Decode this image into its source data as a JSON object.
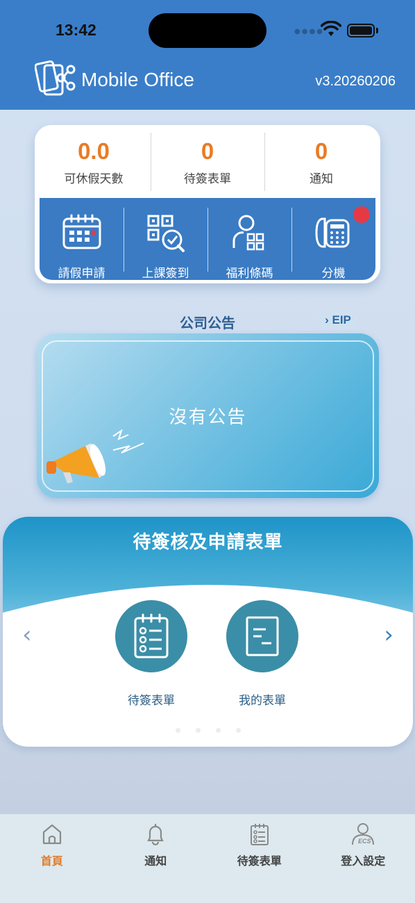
{
  "status_bar": {
    "time": "13:42"
  },
  "header": {
    "app_title": "Mobile Office",
    "version": "v3.20260206"
  },
  "stats": [
    {
      "value": "0.0",
      "label": "可休假天數"
    },
    {
      "value": "0",
      "label": "待簽表單"
    },
    {
      "value": "0",
      "label": "通知"
    }
  ],
  "quick_actions": [
    {
      "label": "請假申請",
      "icon": "calendar-icon"
    },
    {
      "label": "上課簽到",
      "icon": "qr-check-icon"
    },
    {
      "label": "福利條碼",
      "icon": "person-grid-icon"
    },
    {
      "label": "分機",
      "icon": "phone-icon"
    }
  ],
  "announcement": {
    "title": "公司公告",
    "eip_label": "EIP",
    "empty_text": "沒有公告"
  },
  "forms": {
    "title": "待簽核及申請表單",
    "items": [
      {
        "label": "待簽表單",
        "icon": "checklist-icon"
      },
      {
        "label": "我的表單",
        "icon": "document-icon"
      }
    ]
  },
  "tabbar": [
    {
      "label": "首頁",
      "icon": "home-icon",
      "active": true
    },
    {
      "label": "通知",
      "icon": "bell-icon",
      "active": false
    },
    {
      "label": "待簽表單",
      "icon": "clipboard-icon",
      "active": false
    },
    {
      "label": "登入設定",
      "icon": "user-settings-icon",
      "active": false
    }
  ],
  "colors": {
    "header": "#3a7ec9",
    "accent": "#ea7b25",
    "quick_bar": "#3a7bc3",
    "badge": "#e53a45"
  }
}
